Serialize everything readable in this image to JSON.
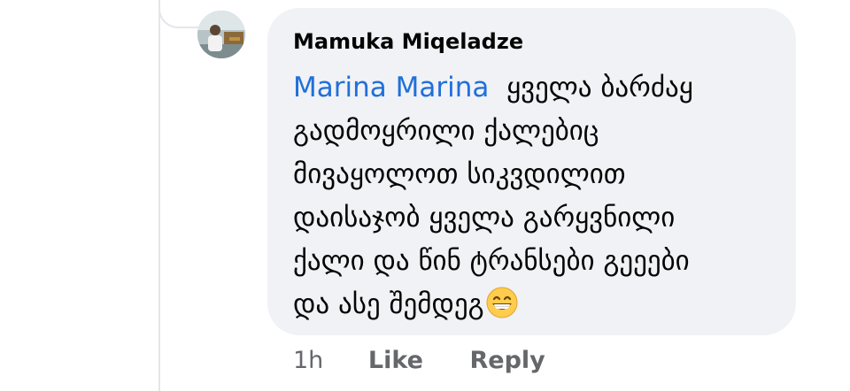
{
  "comment": {
    "author": "Mamuka Miqeladze",
    "mention": "Marina Marina",
    "text_lines": [
      "ყველა ბარძაყ",
      "გადმოყრილი ქალებიც",
      "მივაყოლოთ სიკვდილით",
      "დაისაჯობ ყველა გარყვნილი",
      "ქალი და წინ ტრანსები გეეები",
      "და ასე შემდეგ"
    ],
    "emoji": "grinning-face-with-smiling-eyes"
  },
  "actions": {
    "time": "1h",
    "like_label": "Like",
    "reply_label": "Reply"
  },
  "colors": {
    "bubble_bg": "#f0f2f5",
    "mention": "#216fdb",
    "secondary_text": "#65676b",
    "thread_line": "#e4e6eb"
  }
}
